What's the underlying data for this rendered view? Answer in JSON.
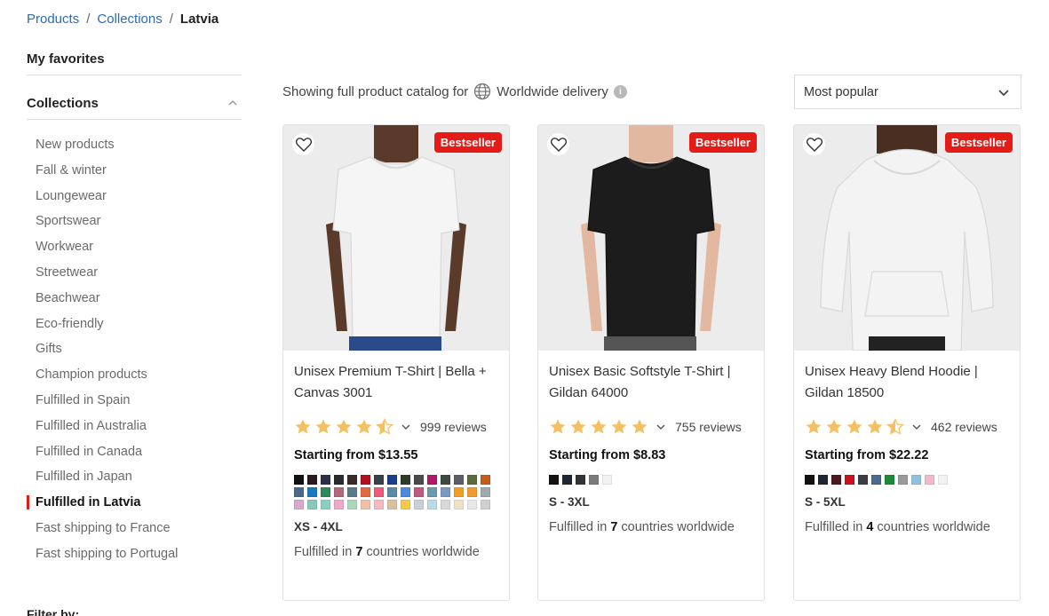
{
  "breadcrumb": {
    "items": [
      "Products",
      "Collections"
    ],
    "current": "Latvia"
  },
  "sidebar": {
    "favorites": "My favorites",
    "collections_title": "Collections",
    "items": [
      {
        "label": "New products",
        "active": false
      },
      {
        "label": "Fall & winter",
        "active": false
      },
      {
        "label": "Loungewear",
        "active": false
      },
      {
        "label": "Sportswear",
        "active": false
      },
      {
        "label": "Workwear",
        "active": false
      },
      {
        "label": "Streetwear",
        "active": false
      },
      {
        "label": "Beachwear",
        "active": false
      },
      {
        "label": "Eco-friendly",
        "active": false
      },
      {
        "label": "Gifts",
        "active": false
      },
      {
        "label": "Champion products",
        "active": false
      },
      {
        "label": "Fulfilled in Spain",
        "active": false
      },
      {
        "label": "Fulfilled in Australia",
        "active": false
      },
      {
        "label": "Fulfilled in Canada",
        "active": false
      },
      {
        "label": "Fulfilled in Japan",
        "active": false
      },
      {
        "label": "Fulfilled in Latvia",
        "active": true
      },
      {
        "label": "Fast shipping to France",
        "active": false
      },
      {
        "label": "Fast shipping to Portugal",
        "active": false
      }
    ],
    "filter_by": "Filter by:"
  },
  "toolbar": {
    "showing_text": "Showing full product catalog for",
    "delivery": "Worldwide delivery",
    "sort_value": "Most popular"
  },
  "products": [
    {
      "badge": "Bestseller",
      "title": "Unisex Premium T-Shirt | Bella + Canvas 3001",
      "rating": 4.5,
      "reviews": "999 reviews",
      "price": "Starting from $13.55",
      "colors": [
        "#111111",
        "#2a1a1f",
        "#2c2f4a",
        "#2b2b2b",
        "#3a2a28",
        "#b01020",
        "#3a3f4a",
        "#1a3f8a",
        "#2d3b2a",
        "#4a4a4a",
        "#b0186a",
        "#3f4a3f",
        "#5a5e65",
        "#5a6a3a",
        "#c85a1a",
        "#4a6a8a",
        "#1a7abf",
        "#2a8a5a",
        "#b06a7a",
        "#5a7a8a",
        "#e06a40",
        "#ee5a7a",
        "#5a8aa8",
        "#4a8ae0",
        "#c05a7a",
        "#6a9ab0",
        "#7a9ac0",
        "#f0a020",
        "#f09a30",
        "#a0a8b0",
        "#d8a8d0",
        "#88c8b8",
        "#8ad0c0",
        "#f0a8c8",
        "#a8d8b8",
        "#f0c0a8",
        "#f8b8c0",
        "#d8c0a0",
        "#f8c848",
        "#c8d0d8",
        "#b8dce8",
        "#d8d8d8",
        "#f0e0c8",
        "#e8e8e8",
        "#d0d0d0"
      ],
      "sizes": "XS - 4XL",
      "fulfilled_prefix": "Fulfilled in",
      "fulfilled_count": "7",
      "fulfilled_suffix": "countries worldwide",
      "shirt_color": "#f5f5f5",
      "skin": "#5a3a2a",
      "garment": "tee"
    },
    {
      "badge": "Bestseller",
      "title": "Unisex Basic Softstyle T-Shirt | Gildan 64000",
      "rating": 5,
      "reviews": "755 reviews",
      "price": "Starting from $8.83",
      "colors": [
        "#111111",
        "#1f2533",
        "#333333",
        "#7a7a7a",
        "#f2f2f2"
      ],
      "sizes": "S - 3XL",
      "fulfilled_prefix": "Fulfilled in",
      "fulfilled_count": "7",
      "fulfilled_suffix": "countries worldwide",
      "shirt_color": "#1c1c1c",
      "skin": "#e2b8a0",
      "garment": "tee"
    },
    {
      "badge": "Bestseller",
      "title": "Unisex Heavy Blend Hoodie | Gildan 18500",
      "rating": 4.5,
      "reviews": "462 reviews",
      "price": "Starting from $22.22",
      "colors": [
        "#111111",
        "#1f2533",
        "#4a1a20",
        "#cc1020",
        "#3a3d44",
        "#4a6a90",
        "#1a8a3a",
        "#9a9a9a",
        "#90c0e0",
        "#f2b8cc",
        "#f2f2f2"
      ],
      "sizes": "S - 5XL",
      "fulfilled_prefix": "Fulfilled in",
      "fulfilled_count": "4",
      "fulfilled_suffix": "countries worldwide",
      "shirt_color": "#f3f3f3",
      "skin": "#4a2e22",
      "garment": "hoodie"
    }
  ]
}
